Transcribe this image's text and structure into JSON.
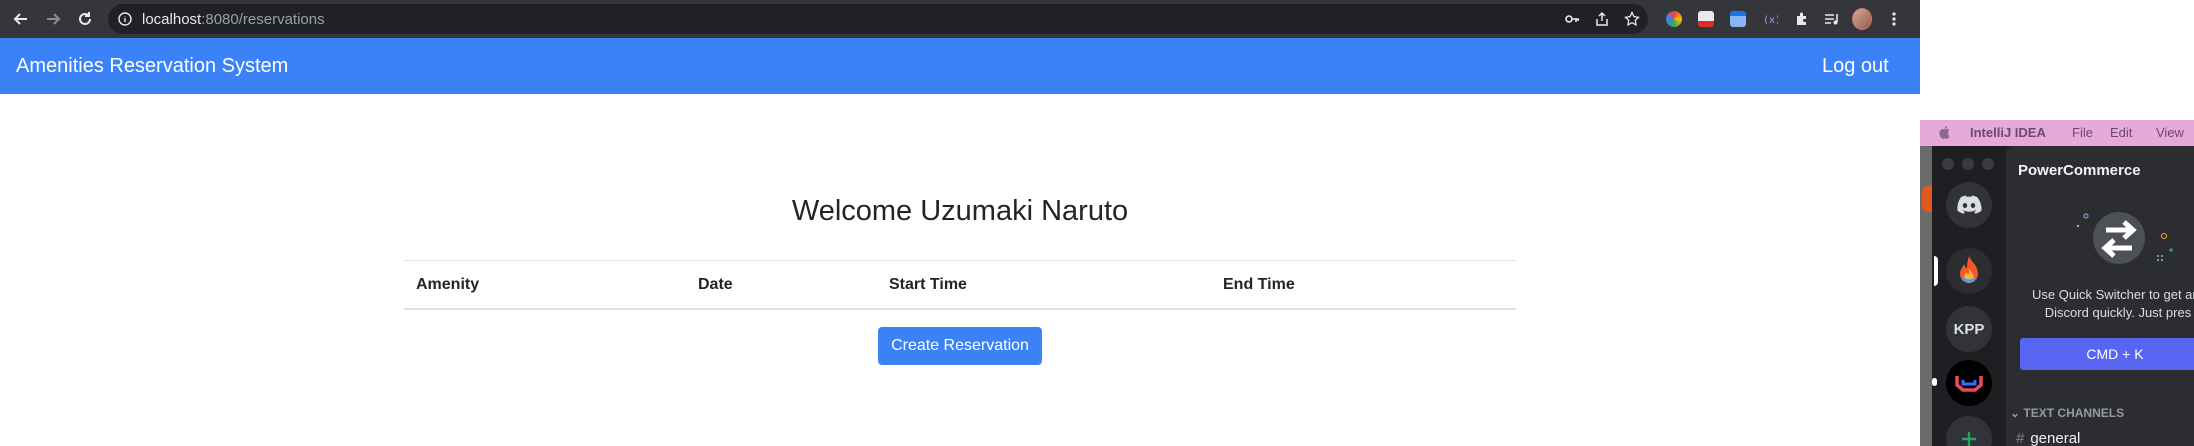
{
  "browser": {
    "url_host": "localhost",
    "url_rest": ":8080/reservations"
  },
  "app": {
    "brand": "Amenities Reservation System",
    "logout_label": "Log out",
    "welcome": "Welcome Uzumaki Naruto",
    "table": {
      "headers": [
        "Amenity",
        "Date",
        "Start Time",
        "End Time"
      ],
      "rows": []
    },
    "create_label": "Create Reservation",
    "colors": {
      "primary": "#3b82f6",
      "toolbar": "#35363a"
    }
  },
  "menubar": {
    "app_name": "IntelliJ IDEA",
    "items": [
      "File",
      "Edit",
      "View"
    ]
  },
  "discord": {
    "servers": [
      "discord-home",
      "fire-server",
      "KPP",
      "red-blue-server",
      "add-server"
    ],
    "kpp_label": "KPP",
    "server_title": "PowerCommerce",
    "quick_switcher_line1": "Use Quick Switcher to get aro",
    "quick_switcher_line2": "Discord quickly. Just pres",
    "cmdk_label": "CMD + K",
    "text_channels_label": "TEXT CHANNELS",
    "channel": "general",
    "colors": {
      "blurple": "#5865f2",
      "bg": "#1e1f22",
      "panel": "#2b2d31"
    }
  }
}
